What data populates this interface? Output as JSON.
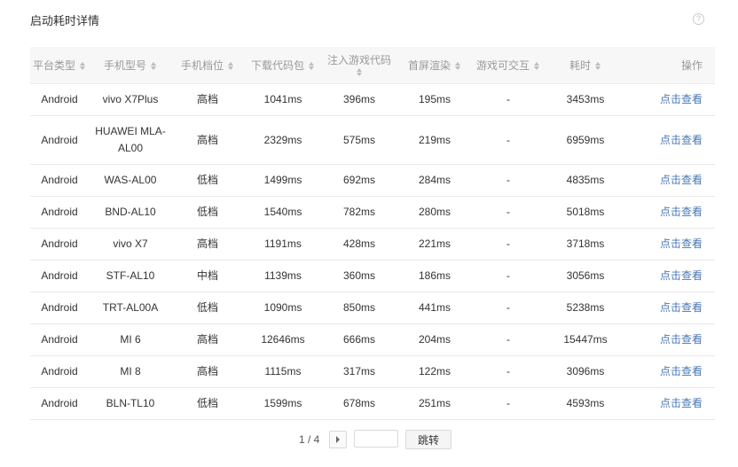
{
  "title": "启动耗时详情",
  "help_icon": "?",
  "columns": [
    {
      "label": "平台类型",
      "sortable": true
    },
    {
      "label": "手机型号",
      "sortable": true
    },
    {
      "label": "手机档位",
      "sortable": true
    },
    {
      "label": "下载代码包",
      "sortable": true
    },
    {
      "label": "注入游戏代码",
      "sortable": true
    },
    {
      "label": "首屏渲染",
      "sortable": true
    },
    {
      "label": "游戏可交互",
      "sortable": true
    },
    {
      "label": "耗时",
      "sortable": true
    },
    {
      "label": "操作",
      "sortable": false
    }
  ],
  "rows": [
    {
      "platform": "Android",
      "model": "vivo X7Plus",
      "tier": "高档",
      "download": "1041ms",
      "inject": "396ms",
      "render": "195ms",
      "interactive": "-",
      "total": "3453ms",
      "action": "点击查看"
    },
    {
      "platform": "Android",
      "model": "HUAWEI MLA-AL00",
      "tier": "高档",
      "download": "2329ms",
      "inject": "575ms",
      "render": "219ms",
      "interactive": "-",
      "total": "6959ms",
      "action": "点击查看"
    },
    {
      "platform": "Android",
      "model": "WAS-AL00",
      "tier": "低档",
      "download": "1499ms",
      "inject": "692ms",
      "render": "284ms",
      "interactive": "-",
      "total": "4835ms",
      "action": "点击查看"
    },
    {
      "platform": "Android",
      "model": "BND-AL10",
      "tier": "低档",
      "download": "1540ms",
      "inject": "782ms",
      "render": "280ms",
      "interactive": "-",
      "total": "5018ms",
      "action": "点击查看"
    },
    {
      "platform": "Android",
      "model": "vivo X7",
      "tier": "高档",
      "download": "1191ms",
      "inject": "428ms",
      "render": "221ms",
      "interactive": "-",
      "total": "3718ms",
      "action": "点击查看"
    },
    {
      "platform": "Android",
      "model": "STF-AL10",
      "tier": "中档",
      "download": "1139ms",
      "inject": "360ms",
      "render": "186ms",
      "interactive": "-",
      "total": "3056ms",
      "action": "点击查看"
    },
    {
      "platform": "Android",
      "model": "TRT-AL00A",
      "tier": "低档",
      "download": "1090ms",
      "inject": "850ms",
      "render": "441ms",
      "interactive": "-",
      "total": "5238ms",
      "action": "点击查看"
    },
    {
      "platform": "Android",
      "model": "MI 6",
      "tier": "高档",
      "download": "12646ms",
      "inject": "666ms",
      "render": "204ms",
      "interactive": "-",
      "total": "15447ms",
      "action": "点击查看"
    },
    {
      "platform": "Android",
      "model": "MI 8",
      "tier": "高档",
      "download": "1115ms",
      "inject": "317ms",
      "render": "122ms",
      "interactive": "-",
      "total": "3096ms",
      "action": "点击查看"
    },
    {
      "platform": "Android",
      "model": "BLN-TL10",
      "tier": "低档",
      "download": "1599ms",
      "inject": "678ms",
      "render": "251ms",
      "interactive": "-",
      "total": "4593ms",
      "action": "点击查看"
    }
  ],
  "pagination": {
    "page_text": "1 / 4",
    "next_icon": "caret-right-icon",
    "input_value": "",
    "jump_label": "跳转"
  },
  "colors": {
    "link": "#4a78b5",
    "header_bg": "#f7f7f7",
    "border": "#e9e9e9"
  }
}
